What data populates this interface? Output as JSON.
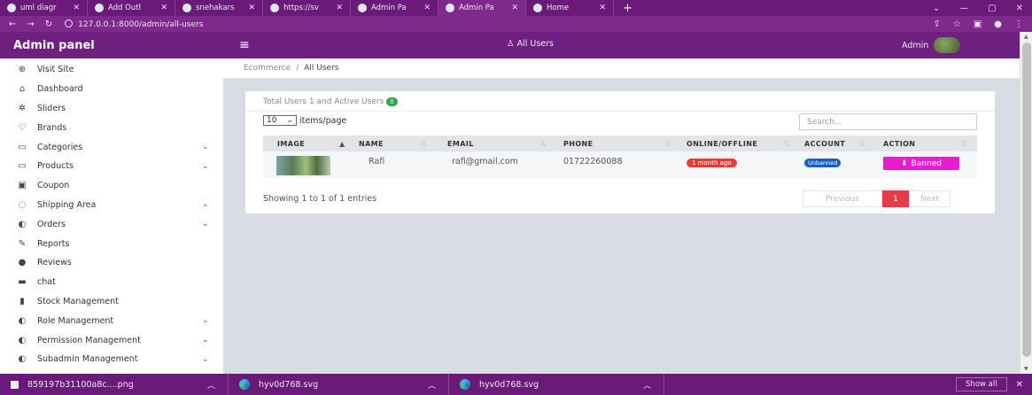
{
  "browser": {
    "tabs": [
      {
        "label": "uml diagr"
      },
      {
        "label": "Add Outl"
      },
      {
        "label": "snehakars"
      },
      {
        "label": "https://sv"
      },
      {
        "label": "Admin Pa"
      },
      {
        "label": "Admin Pa"
      },
      {
        "label": "Home"
      }
    ],
    "new_tab": "+",
    "url": "127.0.0.1:8000/admin/all-users"
  },
  "header": {
    "brand": "Admin panel",
    "center_title": "All Users",
    "user_name": "Admin"
  },
  "sidebar": {
    "items": [
      {
        "label": "Visit Site",
        "icon": "globe-icon",
        "glyph": "⊕",
        "has_submenu": false
      },
      {
        "label": "Dashboard",
        "icon": "dashboard-icon",
        "glyph": "⌂",
        "has_submenu": false
      },
      {
        "label": "Sliders",
        "icon": "sliders-icon",
        "glyph": "✲",
        "has_submenu": false
      },
      {
        "label": "Brands",
        "icon": "brands-icon",
        "glyph": "♡",
        "has_submenu": false
      },
      {
        "label": "Categories",
        "icon": "categories-icon",
        "glyph": "▭",
        "has_submenu": true
      },
      {
        "label": "Products",
        "icon": "products-icon",
        "glyph": "▭",
        "has_submenu": true
      },
      {
        "label": "Coupon",
        "icon": "coupon-icon",
        "glyph": "▣",
        "has_submenu": false
      },
      {
        "label": "Shipping Area",
        "icon": "shipping-icon",
        "glyph": "◌",
        "has_submenu": true
      },
      {
        "label": "Orders",
        "icon": "orders-icon",
        "glyph": "◐",
        "has_submenu": true
      },
      {
        "label": "Reports",
        "icon": "reports-icon",
        "glyph": "✎",
        "has_submenu": false
      },
      {
        "label": "Reviews",
        "icon": "reviews-icon",
        "glyph": "●",
        "has_submenu": false
      },
      {
        "label": "chat",
        "icon": "chat-icon",
        "glyph": "▬",
        "has_submenu": false
      },
      {
        "label": "Stock Management",
        "icon": "stock-icon",
        "glyph": "▮",
        "has_submenu": false
      },
      {
        "label": "Role Management",
        "icon": "role-icon",
        "glyph": "◐",
        "has_submenu": true
      },
      {
        "label": "Permission Management",
        "icon": "permission-icon",
        "glyph": "◐",
        "has_submenu": true
      },
      {
        "label": "Subadmin Management",
        "icon": "subadmin-icon",
        "glyph": "◐",
        "has_submenu": true
      }
    ]
  },
  "breadcrumb": {
    "root": "Ecommerce",
    "separator": "/",
    "current": "All Users"
  },
  "users_card": {
    "summary_prefix": "Total Users 1 and Active Users",
    "active_count": "0",
    "per_page_value": "10",
    "per_page_label": "items/page",
    "search_placeholder": "Search...",
    "columns": [
      "IMAGE",
      "NAME",
      "EMAIL",
      "PHONE",
      "ONLINE/OFFLINE",
      "ACCOUNT",
      "ACTION"
    ],
    "rows": [
      {
        "name": "Rafi",
        "email": "rafi@gmail.com",
        "phone": "01722260088",
        "online_status": "1 month ago",
        "account_status": "Unbanned",
        "action_label": "Banned"
      }
    ],
    "entries_info": "Showing 1 to 1 of 1 entries",
    "pagination": {
      "prev": "Previous",
      "current": "1",
      "next": "Next"
    }
  },
  "downloads": {
    "items": [
      {
        "name": "859197b31100a8c....png"
      },
      {
        "name": "hyv0d768.svg"
      },
      {
        "name": "hyv0d768.svg"
      }
    ],
    "show_all": "Show all"
  },
  "colors": {
    "header_purple": "#6f1f7f",
    "banned_pink": "#ea1bd0",
    "offline_red": "#e83a3a",
    "unbanned_blue": "#1d5fbf",
    "active_green": "#28a745"
  }
}
